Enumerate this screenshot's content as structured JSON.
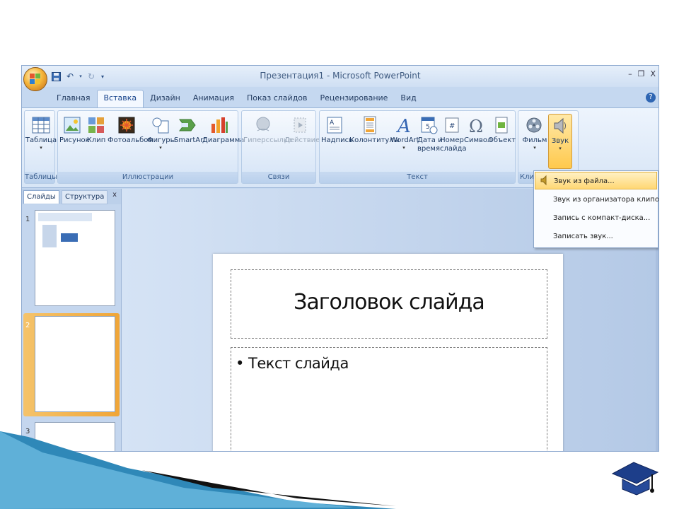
{
  "window": {
    "title": "Презентация1 - Microsoft PowerPoint",
    "controls": [
      "–",
      "❐",
      "X"
    ],
    "help": "?"
  },
  "tabs": [
    {
      "label": "Главная"
    },
    {
      "label": "Вставка",
      "active": true
    },
    {
      "label": "Дизайн"
    },
    {
      "label": "Анимация"
    },
    {
      "label": "Показ слайдов"
    },
    {
      "label": "Рецензирование"
    },
    {
      "label": "Вид"
    }
  ],
  "ribbon": {
    "groups": {
      "tables": "Таблицы",
      "illustrations": "Иллюстрации",
      "links": "Связи",
      "text": "Текст",
      "clips": "Клипы"
    },
    "buttons": {
      "table": "Таблица",
      "picture": "Рисунок",
      "clip": "Клип",
      "photo_album": "Фотоальбом",
      "shapes": "Фигуры",
      "smartart": "SmartArt",
      "chart": "Диаграмма",
      "hyperlink": "Гиперссылка",
      "action": "Действие",
      "textbox": "Надпись",
      "header_footer": "Колонтитулы",
      "wordart": "WordArt",
      "datetime_1": "Дата и",
      "datetime_2": "время",
      "slide_number_1": "Номер",
      "slide_number_2": "слайда",
      "symbol": "Символ",
      "object": "Объект",
      "movie": "Фильм",
      "sound": "Звук"
    }
  },
  "sound_menu": {
    "items": [
      {
        "label": "Звук из файла...",
        "highlighted": true
      },
      {
        "label": "Звук из организатора клипов..."
      },
      {
        "label": "Запись с компакт-диска..."
      },
      {
        "label": "Записать звук..."
      }
    ]
  },
  "slides_pane": {
    "tab_slides": "Слайды",
    "tab_structure": "Структура",
    "close": "x",
    "thumbnails": [
      "1",
      "2",
      "3"
    ]
  },
  "slide": {
    "title": "Заголовок слайда",
    "body": "• Текст слайда"
  },
  "colors": {
    "window_bg": "#c5d8f0",
    "accent_orange": "#f0a537",
    "menu_highlight": "#ffd774",
    "decor_blue": "#2f88b8"
  }
}
